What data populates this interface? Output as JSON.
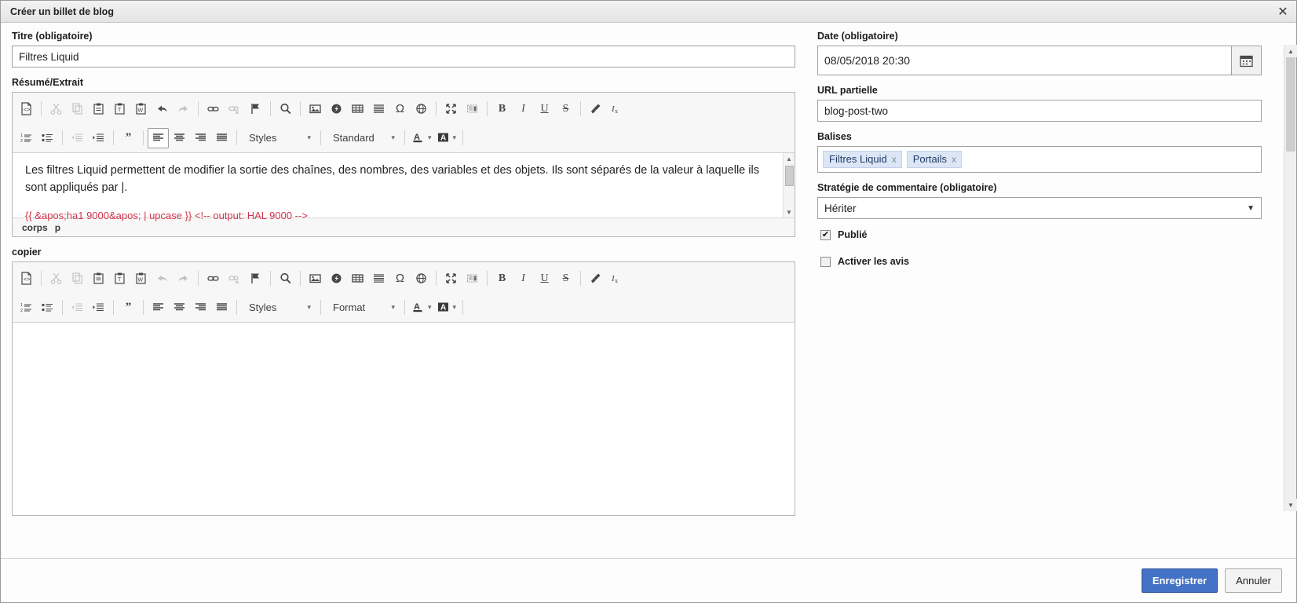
{
  "window": {
    "title": "Créer un billet de blog",
    "close_icon": "close-icon"
  },
  "left": {
    "title_label": "Titre (obligatoire)",
    "title_value": "Filtres Liquid",
    "summary_label": "Résumé/Extrait",
    "copy_label": "copier"
  },
  "editor1": {
    "styles_label": "Styles",
    "format_label": "Standard",
    "paragraph": "Les filtres Liquid permettent de modifier la sortie des chaînes, des nombres, des variables et des objets. Ils sont séparés de la valeur à laquelle ils sont appliqués par |.",
    "code_line": "{{ &apos;ha1 9000&apos; | upcase }} <!-- output: HAL 9000 -->",
    "elements_path": [
      "corps",
      "p"
    ]
  },
  "editor2": {
    "styles_label": "Styles",
    "format_label": "Format",
    "content": ""
  },
  "toolbar_icons": {
    "source": "source-icon",
    "cut": "cut-icon",
    "copy": "copy-icon",
    "paste": "paste-icon",
    "paste_text": "paste-text-icon",
    "paste_word": "paste-word-icon",
    "undo": "undo-icon",
    "redo": "redo-icon",
    "link": "link-icon",
    "unlink": "unlink-icon",
    "anchor": "anchor-flag-icon",
    "find": "search-icon",
    "image": "image-icon",
    "flash": "flash-icon",
    "table": "table-icon",
    "horizontal_rule": "horizontal-rule-icon",
    "special_char": "special-character-icon",
    "iframe": "iframe-globe-icon",
    "maximize": "maximize-icon",
    "show_blocks": "show-blocks-icon",
    "bold": "bold-icon",
    "italic": "italic-icon",
    "underline": "underline-icon",
    "strike": "strikethrough-icon",
    "remove_format": "remove-format-icon",
    "subscript": "remove-text-format-icon",
    "numbered_list": "numbered-list-icon",
    "bulleted_list": "bulleted-list-icon",
    "outdent": "outdent-icon",
    "indent": "indent-icon",
    "blockquote": "blockquote-icon",
    "align_left": "align-left-icon",
    "align_center": "align-center-icon",
    "align_right": "align-right-icon",
    "justify": "justify-icon",
    "text_color": "text-color-icon",
    "bg_color": "background-color-icon"
  },
  "right": {
    "date_label": "Date (obligatoire)",
    "date_value": "08/05/2018 20:30",
    "calendar_icon": "calendar-icon",
    "url_label": "URL partielle",
    "url_value": "blog-post-two",
    "tags_label": "Balises",
    "tags": [
      {
        "label": "Filtres Liquid",
        "remove": "x"
      },
      {
        "label": "Portails",
        "remove": "x"
      }
    ],
    "comment_label": "Stratégie de commentaire (obligatoire)",
    "comment_value": "Hériter",
    "published_label": "Publié",
    "published_checked": true,
    "reviews_label": "Activer les avis",
    "reviews_checked": false
  },
  "footer": {
    "save_label": "Enregistrer",
    "cancel_label": "Annuler"
  },
  "colors": {
    "primary": "#4472c4",
    "code_red": "#d1354a",
    "tag_bg": "#dde6f5"
  }
}
